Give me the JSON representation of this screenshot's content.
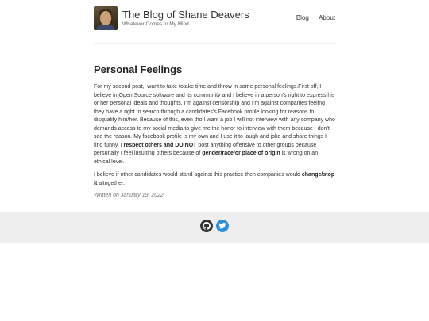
{
  "site": {
    "title": "The Blog of Shane Deavers",
    "tagline": "Whatever Comes to My Mind"
  },
  "nav": {
    "items": [
      {
        "label": "Blog"
      },
      {
        "label": "About"
      }
    ]
  },
  "post": {
    "title": "Personal Feelings",
    "p1": {
      "t1": "For my second post,I want to take totake time and throw in some personal feelings.First off, I believe in Open Source software and its community and I believe in a person’s right to express his or her personal ideals and thoughts. I’m against censorship and I’m against companies feeling they have a right to search through a candidates’s Facebook profile looking for reasons to disqualify him/her. Because of this, even tho I want a job I will not interview with any company who demands access to my social media to give me the honor to interview with them because I don’t see the reason. My facebook profile is my own and I use it to laugh and joke and share things I find funny. I ",
      "b1": "respect others and DO NOT",
      "t2": " post anything offensive to other groups because personally I feel insulting others because of ",
      "b2": "gender/race/or place of origin",
      "t3": " is wrong on an ethical level."
    },
    "p2": {
      "t1": "I believe if other candidates would stand against this practice then companies would ",
      "b1": "change/stop it",
      "t2": " altogether."
    },
    "date": "Written on January 19, 2022"
  },
  "footer": {
    "icons": [
      "github-icon",
      "twitter-icon"
    ],
    "colors": {
      "github": "#333333",
      "twitter": "#2f8fdc"
    }
  }
}
